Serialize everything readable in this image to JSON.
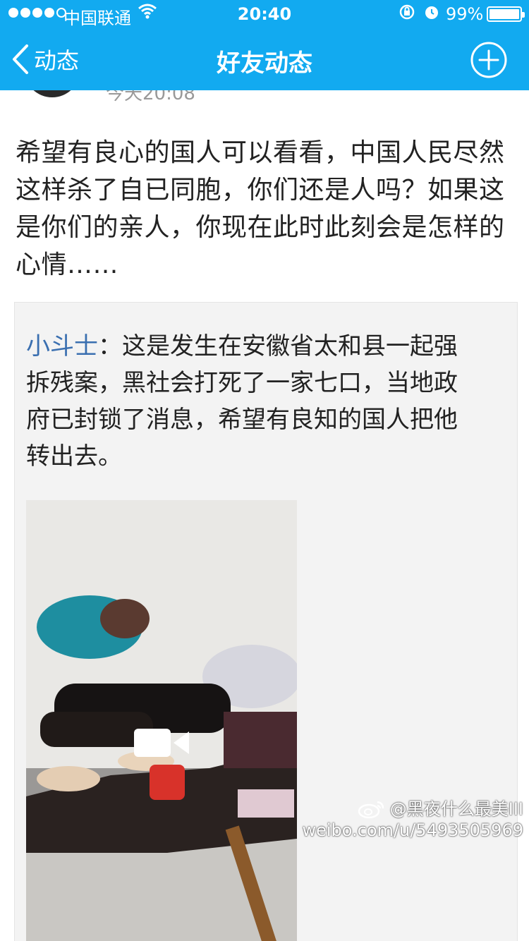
{
  "status_bar": {
    "carrier": "中国联通",
    "time": "20:40",
    "battery_percent": "99%",
    "battery_level": 0.99,
    "signal_bars_filled": 4,
    "signal_bars_total": 5
  },
  "nav": {
    "back_label": "动态",
    "title": "好友动态"
  },
  "post": {
    "meta_partial": "今天20:08",
    "text": "希望有良心的国人可以看看，中国人民尽然这样杀了自已同胞，你们还是人吗？如果这是你们的亲人，你现在此时此刻会是怎样的心情……"
  },
  "quote": {
    "author": "小斗士",
    "separator": "：",
    "text": "这是发生在安徽省太和县一起强拆残案，黑社会打死了一家七口，当地政府已封锁了消息，希望有良知的国人把他转出去。"
  },
  "watermark": {
    "line1": "@黑夜什么最美III",
    "line2": "weibo.com/u/5493505969"
  },
  "colors": {
    "accent": "#12aaf0",
    "author_link": "#3a6fb0",
    "quote_bg": "#f3f3f3"
  },
  "icons": {
    "back": "chevron-left-icon",
    "add": "plus-circle-icon",
    "video": "video-camera-icon"
  }
}
